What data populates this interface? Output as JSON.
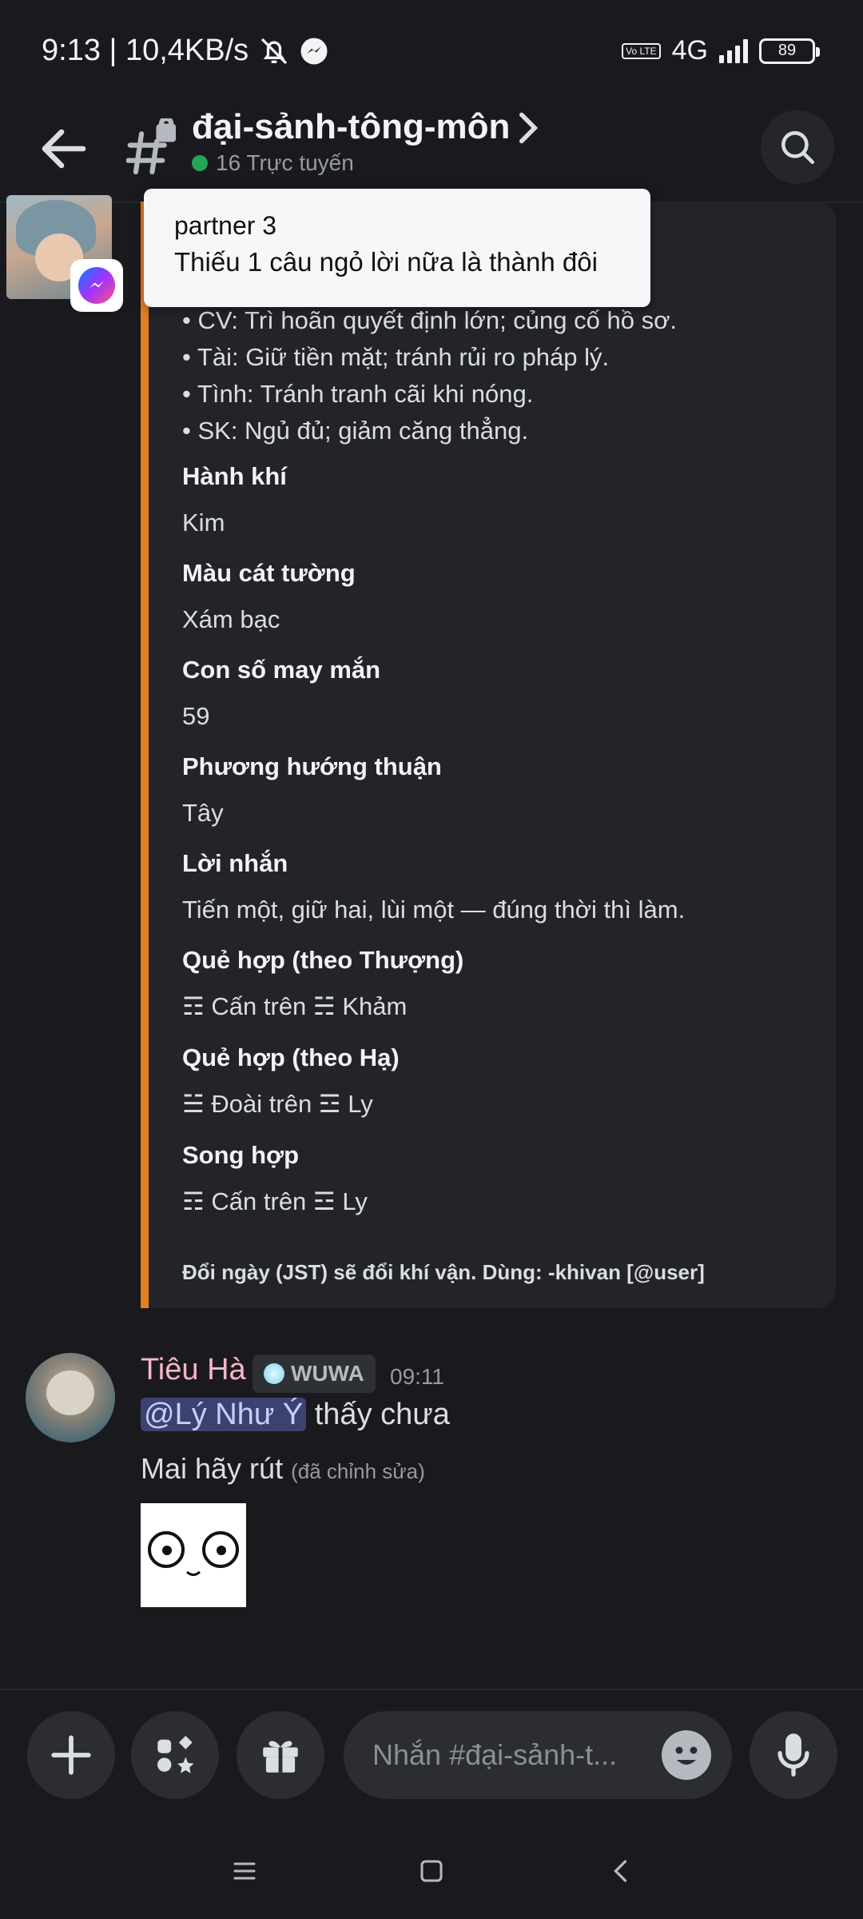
{
  "status_bar": {
    "time_speed": "9:13 | 10,4KB/s",
    "network_badge": "Vo LTE",
    "network_type": "4G",
    "battery": "89"
  },
  "header": {
    "channel_name": "đại-sảnh-tông-môn",
    "online_count": "16 Trực tuyến"
  },
  "notification": {
    "title": "partner 3",
    "body": "Thiếu 1 câu ngỏ lời nữa là thành đôi"
  },
  "embed": {
    "accent_color": "#e67e22",
    "lines": [
      "• CV: Trì hoãn quyết định lớn; củng cố hồ sơ.",
      "• Tài: Giữ tiền mặt; tránh rủi ro pháp lý.",
      "• Tình: Tránh tranh cãi khi nóng.",
      "• SK: Ngủ đủ; giảm căng thẳng."
    ],
    "fields": [
      {
        "name": "Hành khí",
        "value": "Kim"
      },
      {
        "name": "Màu cát tường",
        "value": "Xám bạc"
      },
      {
        "name": "Con số may mắn",
        "value": "59"
      },
      {
        "name": "Phương hướng thuận",
        "value": "Tây"
      },
      {
        "name": "Lời nhắn",
        "value": "Tiến một, giữ hai, lùi một — đúng thời thì làm."
      },
      {
        "name": "Quẻ hợp (theo Thượng)",
        "value": "☶ Cấn trên ☵ Khảm"
      },
      {
        "name": "Quẻ hợp (theo Hạ)",
        "value": "☱ Đoài trên ☲ Ly"
      },
      {
        "name": "Song hợp",
        "value": "☶ Cấn trên ☲ Ly"
      }
    ],
    "footer": "Đổi ngày (JST) sẽ đổi khí vận. Dùng: -khivan [@user]"
  },
  "message": {
    "author": "Tiêu Hà",
    "role_tag": "WUWA",
    "time": "09:11",
    "mention": "@Lý Như Ý",
    "line1_rest": " thấy chưa",
    "line2": "Mai hãy rút",
    "edited": "(đã chỉnh sửa)"
  },
  "composer": {
    "placeholder": "Nhắn #đại-sảnh-t..."
  }
}
